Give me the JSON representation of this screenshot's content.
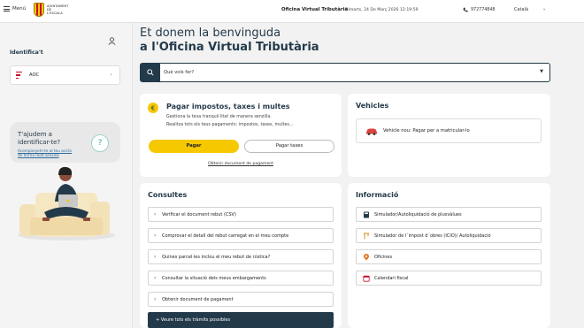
{
  "topbar": {
    "menu_label": "Menú",
    "logo_line1": "AJUNTAMENT",
    "logo_line2": "DE",
    "logo_line3": "L'ESCALA",
    "office_title": "Oficina Virtual Tributària",
    "datetime": "Dimarts, 24 De Març 2026 12:19:59",
    "phone": "972774848",
    "language": "Català"
  },
  "sidebar": {
    "identify_title": "Identifica't",
    "aoc_label": "AOC",
    "help_title": "T'ajudem a identificar-te?",
    "help_link": "Acompanyem-te al teu accés de forma molt senzilla",
    "help_icon": "?"
  },
  "main": {
    "welcome_line1": "Et donem la benvinguda",
    "welcome_line2": "a l'Oficina Virtual Tributària",
    "search_placeholder": "Què vols fer?",
    "taxes": {
      "title": "Pagar impostos, taxes i multes",
      "desc1": "Gestiona la teva tranquil·litat de manera senzilla.",
      "desc2": "Realitza tots els teus pagaments: impostos, taxes, multes...",
      "pay_button": "Pagar",
      "fees_button": "Pagar taxes",
      "doc_link": "Obtenir document de pagament"
    },
    "vehicles": {
      "title": "Vehicles",
      "item": "Vehicle nou: Pagar per a matricular-lo"
    },
    "consultes": {
      "title": "Consultes",
      "items": [
        "Verificar el document rebut (CSV)",
        "Comprovar el detall del rebut carregat en el meu compte",
        "Quines parcel·les inclou el meu rebut de rústica?",
        "Consultar la situació dels meus embargaments",
        "Obtenir document de pagament"
      ],
      "all_button": "+ Veure tots els tràmits possibles"
    },
    "info": {
      "title": "Informació",
      "items": [
        "Simulador/Autoliquidació de plusvàlues",
        "Simulador de l´impost d´obres (ICIO)/ Autoliquidació",
        "Oficines",
        "Calendari fiscal"
      ]
    }
  },
  "colors": {
    "navy": "#233a4a",
    "accent_yellow": "#f6c800",
    "red": "#c8102e"
  }
}
